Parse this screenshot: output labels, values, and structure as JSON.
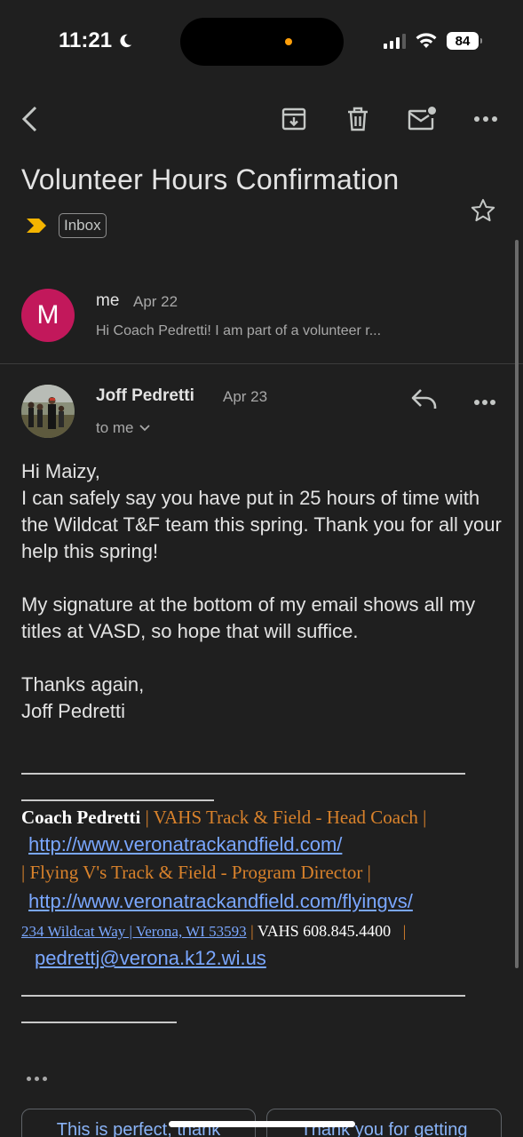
{
  "status": {
    "time": "11:21",
    "battery": "84"
  },
  "toolbar": {
    "back_icon": "chevron-left-icon",
    "archive_icon": "archive-icon",
    "delete_icon": "trash-icon",
    "unread_icon": "mail-unread-icon",
    "more_icon": "more-horizontal-icon"
  },
  "email": {
    "subject": "Volunteer Hours Confirmation",
    "label": "Inbox",
    "importance_color": "#f4b400"
  },
  "collapsed_message": {
    "avatar_letter": "M",
    "avatar_color": "#c2185b",
    "sender": "me",
    "date": "Apr 22",
    "snippet": "Hi Coach Pedretti! I am part of a volunteer r..."
  },
  "message": {
    "sender": "Joff Pedretti",
    "date": "Apr 23",
    "recipient": "to me",
    "body": [
      "Hi Maizy,\nI can safely say you have put in 25 hours of time with the Wildcat T&F team this spring. Thank you for all your help this spring!",
      "My signature at the bottom of my email shows all my titles at VASD, so hope that will suffice.",
      "Thanks again,\nJoff Pedretti"
    ],
    "signature": {
      "name": "Coach Pedretti",
      "title1": " | VAHS Track & Field - Head Coach |",
      "link1": "http://www.veronatrackandfield.com/",
      "title2": "| Flying V's Track & Field - Program Director |",
      "link2": "http://www.veronatrackandfield.com/flyingvs/",
      "address": "234 Wildcat Way | Verona, WI 53593",
      "sep": " | ",
      "phone": "VAHS 608.845.4400",
      "sep2": "|",
      "email": "pedrettj@verona.k12.wi.us"
    }
  },
  "smart_replies": [
    "This is perfect, thank",
    "Thank you for getting"
  ]
}
